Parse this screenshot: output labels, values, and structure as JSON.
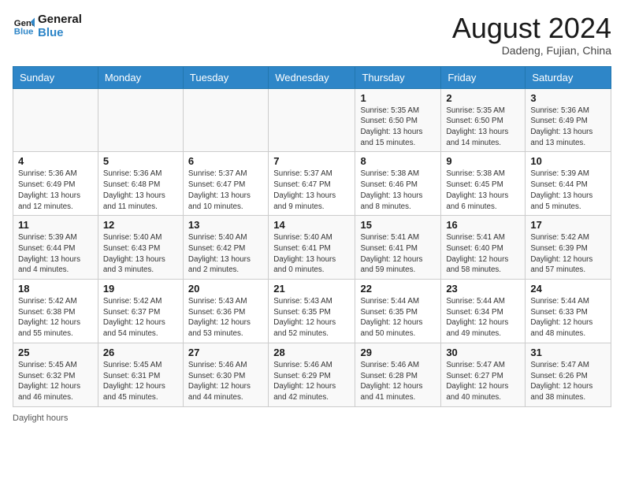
{
  "header": {
    "logo_line1": "General",
    "logo_line2": "Blue",
    "month_title": "August 2024",
    "location": "Dadeng, Fujian, China"
  },
  "days_of_week": [
    "Sunday",
    "Monday",
    "Tuesday",
    "Wednesday",
    "Thursday",
    "Friday",
    "Saturday"
  ],
  "weeks": [
    [
      {
        "day": "",
        "info": ""
      },
      {
        "day": "",
        "info": ""
      },
      {
        "day": "",
        "info": ""
      },
      {
        "day": "",
        "info": ""
      },
      {
        "day": "1",
        "info": "Sunrise: 5:35 AM\nSunset: 6:50 PM\nDaylight: 13 hours\nand 15 minutes."
      },
      {
        "day": "2",
        "info": "Sunrise: 5:35 AM\nSunset: 6:50 PM\nDaylight: 13 hours\nand 14 minutes."
      },
      {
        "day": "3",
        "info": "Sunrise: 5:36 AM\nSunset: 6:49 PM\nDaylight: 13 hours\nand 13 minutes."
      }
    ],
    [
      {
        "day": "4",
        "info": "Sunrise: 5:36 AM\nSunset: 6:49 PM\nDaylight: 13 hours\nand 12 minutes."
      },
      {
        "day": "5",
        "info": "Sunrise: 5:36 AM\nSunset: 6:48 PM\nDaylight: 13 hours\nand 11 minutes."
      },
      {
        "day": "6",
        "info": "Sunrise: 5:37 AM\nSunset: 6:47 PM\nDaylight: 13 hours\nand 10 minutes."
      },
      {
        "day": "7",
        "info": "Sunrise: 5:37 AM\nSunset: 6:47 PM\nDaylight: 13 hours\nand 9 minutes."
      },
      {
        "day": "8",
        "info": "Sunrise: 5:38 AM\nSunset: 6:46 PM\nDaylight: 13 hours\nand 8 minutes."
      },
      {
        "day": "9",
        "info": "Sunrise: 5:38 AM\nSunset: 6:45 PM\nDaylight: 13 hours\nand 6 minutes."
      },
      {
        "day": "10",
        "info": "Sunrise: 5:39 AM\nSunset: 6:44 PM\nDaylight: 13 hours\nand 5 minutes."
      }
    ],
    [
      {
        "day": "11",
        "info": "Sunrise: 5:39 AM\nSunset: 6:44 PM\nDaylight: 13 hours\nand 4 minutes."
      },
      {
        "day": "12",
        "info": "Sunrise: 5:40 AM\nSunset: 6:43 PM\nDaylight: 13 hours\nand 3 minutes."
      },
      {
        "day": "13",
        "info": "Sunrise: 5:40 AM\nSunset: 6:42 PM\nDaylight: 13 hours\nand 2 minutes."
      },
      {
        "day": "14",
        "info": "Sunrise: 5:40 AM\nSunset: 6:41 PM\nDaylight: 13 hours\nand 0 minutes."
      },
      {
        "day": "15",
        "info": "Sunrise: 5:41 AM\nSunset: 6:41 PM\nDaylight: 12 hours\nand 59 minutes."
      },
      {
        "day": "16",
        "info": "Sunrise: 5:41 AM\nSunset: 6:40 PM\nDaylight: 12 hours\nand 58 minutes."
      },
      {
        "day": "17",
        "info": "Sunrise: 5:42 AM\nSunset: 6:39 PM\nDaylight: 12 hours\nand 57 minutes."
      }
    ],
    [
      {
        "day": "18",
        "info": "Sunrise: 5:42 AM\nSunset: 6:38 PM\nDaylight: 12 hours\nand 55 minutes."
      },
      {
        "day": "19",
        "info": "Sunrise: 5:42 AM\nSunset: 6:37 PM\nDaylight: 12 hours\nand 54 minutes."
      },
      {
        "day": "20",
        "info": "Sunrise: 5:43 AM\nSunset: 6:36 PM\nDaylight: 12 hours\nand 53 minutes."
      },
      {
        "day": "21",
        "info": "Sunrise: 5:43 AM\nSunset: 6:35 PM\nDaylight: 12 hours\nand 52 minutes."
      },
      {
        "day": "22",
        "info": "Sunrise: 5:44 AM\nSunset: 6:35 PM\nDaylight: 12 hours\nand 50 minutes."
      },
      {
        "day": "23",
        "info": "Sunrise: 5:44 AM\nSunset: 6:34 PM\nDaylight: 12 hours\nand 49 minutes."
      },
      {
        "day": "24",
        "info": "Sunrise: 5:44 AM\nSunset: 6:33 PM\nDaylight: 12 hours\nand 48 minutes."
      }
    ],
    [
      {
        "day": "25",
        "info": "Sunrise: 5:45 AM\nSunset: 6:32 PM\nDaylight: 12 hours\nand 46 minutes."
      },
      {
        "day": "26",
        "info": "Sunrise: 5:45 AM\nSunset: 6:31 PM\nDaylight: 12 hours\nand 45 minutes."
      },
      {
        "day": "27",
        "info": "Sunrise: 5:46 AM\nSunset: 6:30 PM\nDaylight: 12 hours\nand 44 minutes."
      },
      {
        "day": "28",
        "info": "Sunrise: 5:46 AM\nSunset: 6:29 PM\nDaylight: 12 hours\nand 42 minutes."
      },
      {
        "day": "29",
        "info": "Sunrise: 5:46 AM\nSunset: 6:28 PM\nDaylight: 12 hours\nand 41 minutes."
      },
      {
        "day": "30",
        "info": "Sunrise: 5:47 AM\nSunset: 6:27 PM\nDaylight: 12 hours\nand 40 minutes."
      },
      {
        "day": "31",
        "info": "Sunrise: 5:47 AM\nSunset: 6:26 PM\nDaylight: 12 hours\nand 38 minutes."
      }
    ]
  ],
  "footer": {
    "daylight_label": "Daylight hours"
  }
}
